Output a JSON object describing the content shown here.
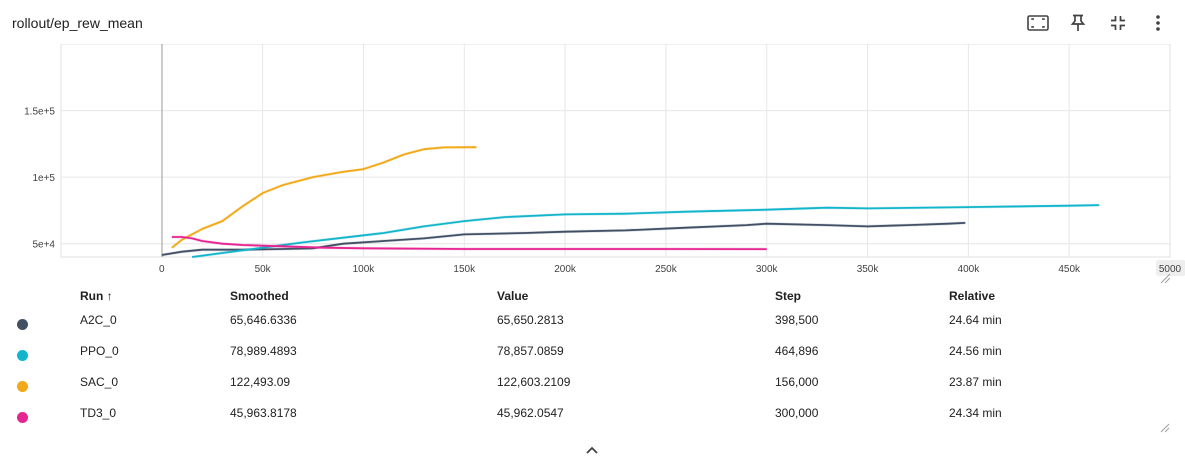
{
  "card": {
    "title": "rollout/ep_rew_mean"
  },
  "toolbar": {
    "buttons": [
      {
        "name": "fit-domain-button",
        "icon": "fit-screen-icon"
      },
      {
        "name": "pin-button",
        "icon": "pin-icon"
      },
      {
        "name": "collapse-button",
        "icon": "collapse-icon"
      },
      {
        "name": "more-button",
        "icon": "more-vert-icon"
      }
    ]
  },
  "chart_data": {
    "type": "line",
    "title": "",
    "xlabel": "",
    "ylabel": "",
    "xlim": [
      -50000,
      500000
    ],
    "ylim": [
      40000,
      200000
    ],
    "x_ticks": [
      {
        "v": 0,
        "label": "0"
      },
      {
        "v": 50000,
        "label": "50k"
      },
      {
        "v": 100000,
        "label": "100k"
      },
      {
        "v": 150000,
        "label": "150k"
      },
      {
        "v": 200000,
        "label": "200k"
      },
      {
        "v": 250000,
        "label": "250k"
      },
      {
        "v": 300000,
        "label": "300k"
      },
      {
        "v": 350000,
        "label": "350k"
      },
      {
        "v": 400000,
        "label": "400k"
      },
      {
        "v": 450000,
        "label": "450k"
      },
      {
        "v": 500000,
        "label": "5000"
      }
    ],
    "y_ticks": [
      {
        "v": 50000,
        "label": "5e+4"
      },
      {
        "v": 100000,
        "label": "1e+5"
      },
      {
        "v": 150000,
        "label": "1.5e+5"
      }
    ],
    "grid": true,
    "series": [
      {
        "name": "A2C_0",
        "color": "#425066",
        "x": [
          0,
          10000,
          20000,
          40000,
          60000,
          75000,
          90000,
          110000,
          130000,
          150000,
          180000,
          200000,
          230000,
          260000,
          290000,
          300000,
          330000,
          350000,
          370000,
          390000,
          398500
        ],
        "y": [
          41500,
          44000,
          45500,
          45500,
          46000,
          46500,
          50000,
          52000,
          54000,
          57000,
          58000,
          59000,
          60000,
          62000,
          64000,
          65000,
          64000,
          63000,
          64000,
          65000,
          65650
        ]
      },
      {
        "name": "PPO_0",
        "color": "#12b5cb",
        "x": [
          15000,
          30000,
          50000,
          70000,
          90000,
          110000,
          130000,
          150000,
          170000,
          200000,
          230000,
          260000,
          300000,
          330000,
          350000,
          400000,
          450000,
          464896
        ],
        "y": [
          40000,
          43000,
          47000,
          51000,
          54500,
          58000,
          63000,
          67000,
          70000,
          72000,
          72500,
          74000,
          75500,
          77000,
          76500,
          77500,
          78500,
          78989
        ]
      },
      {
        "name": "SAC_0",
        "color": "#f2a818",
        "x": [
          5000,
          10000,
          20000,
          30000,
          40000,
          50000,
          60000,
          75000,
          90000,
          100000,
          110000,
          120000,
          130000,
          140000,
          156000
        ],
        "y": [
          47000,
          53000,
          61000,
          67000,
          78000,
          88000,
          94000,
          100000,
          104000,
          106000,
          111000,
          117000,
          121000,
          122300,
          122500
        ]
      },
      {
        "name": "TD3_0",
        "color": "#e52592",
        "x": [
          5000,
          10000,
          15000,
          20000,
          30000,
          40000,
          50000,
          60000,
          80000,
          100000,
          150000,
          200000,
          250000,
          300000
        ],
        "y": [
          55000,
          55000,
          54000,
          52000,
          50000,
          49000,
          48500,
          48000,
          47000,
          46500,
          46000,
          46000,
          46000,
          45964
        ]
      }
    ]
  },
  "table": {
    "headers": {
      "run": "Run ↑",
      "smoothed": "Smoothed",
      "value": "Value",
      "step": "Step",
      "relative": "Relative"
    },
    "rows": [
      {
        "color": "#425066",
        "run": "A2C_0",
        "smoothed": "65,646.6336",
        "value": "65,650.2813",
        "step": "398,500",
        "relative": "24.64 min"
      },
      {
        "color": "#12b5cb",
        "run": "PPO_0",
        "smoothed": "78,989.4893",
        "value": "78,857.0859",
        "step": "464,896",
        "relative": "24.56 min"
      },
      {
        "color": "#f2a818",
        "run": "SAC_0",
        "smoothed": "122,493.09",
        "value": "122,603.2109",
        "step": "156,000",
        "relative": "23.87 min"
      },
      {
        "color": "#e52592",
        "run": "TD3_0",
        "smoothed": "45,963.8178",
        "value": "45,962.0547",
        "step": "300,000",
        "relative": "24.34 min"
      }
    ]
  },
  "footer": {
    "expand_icon": "chevron-up-icon"
  }
}
